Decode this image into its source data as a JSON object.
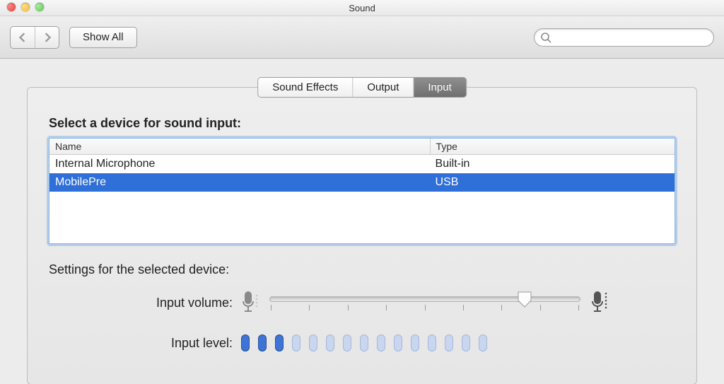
{
  "window": {
    "title": "Sound"
  },
  "toolbar": {
    "back_enabled": false,
    "forward_enabled": false,
    "show_all_label": "Show All",
    "search_placeholder": ""
  },
  "tabs": {
    "items": [
      {
        "label": "Sound Effects",
        "selected": false
      },
      {
        "label": "Output",
        "selected": false
      },
      {
        "label": "Input",
        "selected": true
      }
    ]
  },
  "section": {
    "select_title": "Select a device for sound input:",
    "columns": {
      "name": "Name",
      "type": "Type"
    },
    "devices": [
      {
        "name": "Internal Microphone",
        "type": "Built-in",
        "selected": false
      },
      {
        "name": "MobilePre",
        "type": "USB",
        "selected": true
      }
    ]
  },
  "settings": {
    "title": "Settings for the selected device:",
    "volume_label": "Input volume:",
    "level_label": "Input level:",
    "volume_value": 0.82,
    "tick_count": 9,
    "level_cells": 15,
    "level_active": 3
  },
  "colors": {
    "selection": "#2f6fd8",
    "focus_ring": "#5a97e2"
  }
}
